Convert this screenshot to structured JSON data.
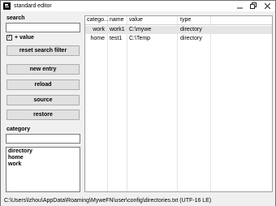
{
  "window": {
    "title": "standard editor"
  },
  "search": {
    "label": "search",
    "value": ""
  },
  "value_checkbox": {
    "checked": true,
    "label": "+ value"
  },
  "buttons": {
    "reset": "reset search filter",
    "new_entry": "new entry",
    "reload": "reload",
    "source": "source",
    "restore": "restore"
  },
  "category": {
    "label": "category",
    "value": "",
    "items": [
      "directory",
      "home",
      "work"
    ]
  },
  "table": {
    "columns": [
      "catego...",
      "name",
      "value",
      "type"
    ],
    "rows": [
      {
        "category": "work",
        "name": "work1",
        "value": "C:\\mywe",
        "type": "directory",
        "selected": true
      },
      {
        "category": "home",
        "name": "test1",
        "value": "C:\\Temp",
        "type": "directory",
        "selected": false
      }
    ]
  },
  "status": {
    "path": "C:\\Users\\lzhou\\AppData\\Roaming\\MyweFN\\user\\config\\directories.txt (UTF-16 LE)"
  }
}
